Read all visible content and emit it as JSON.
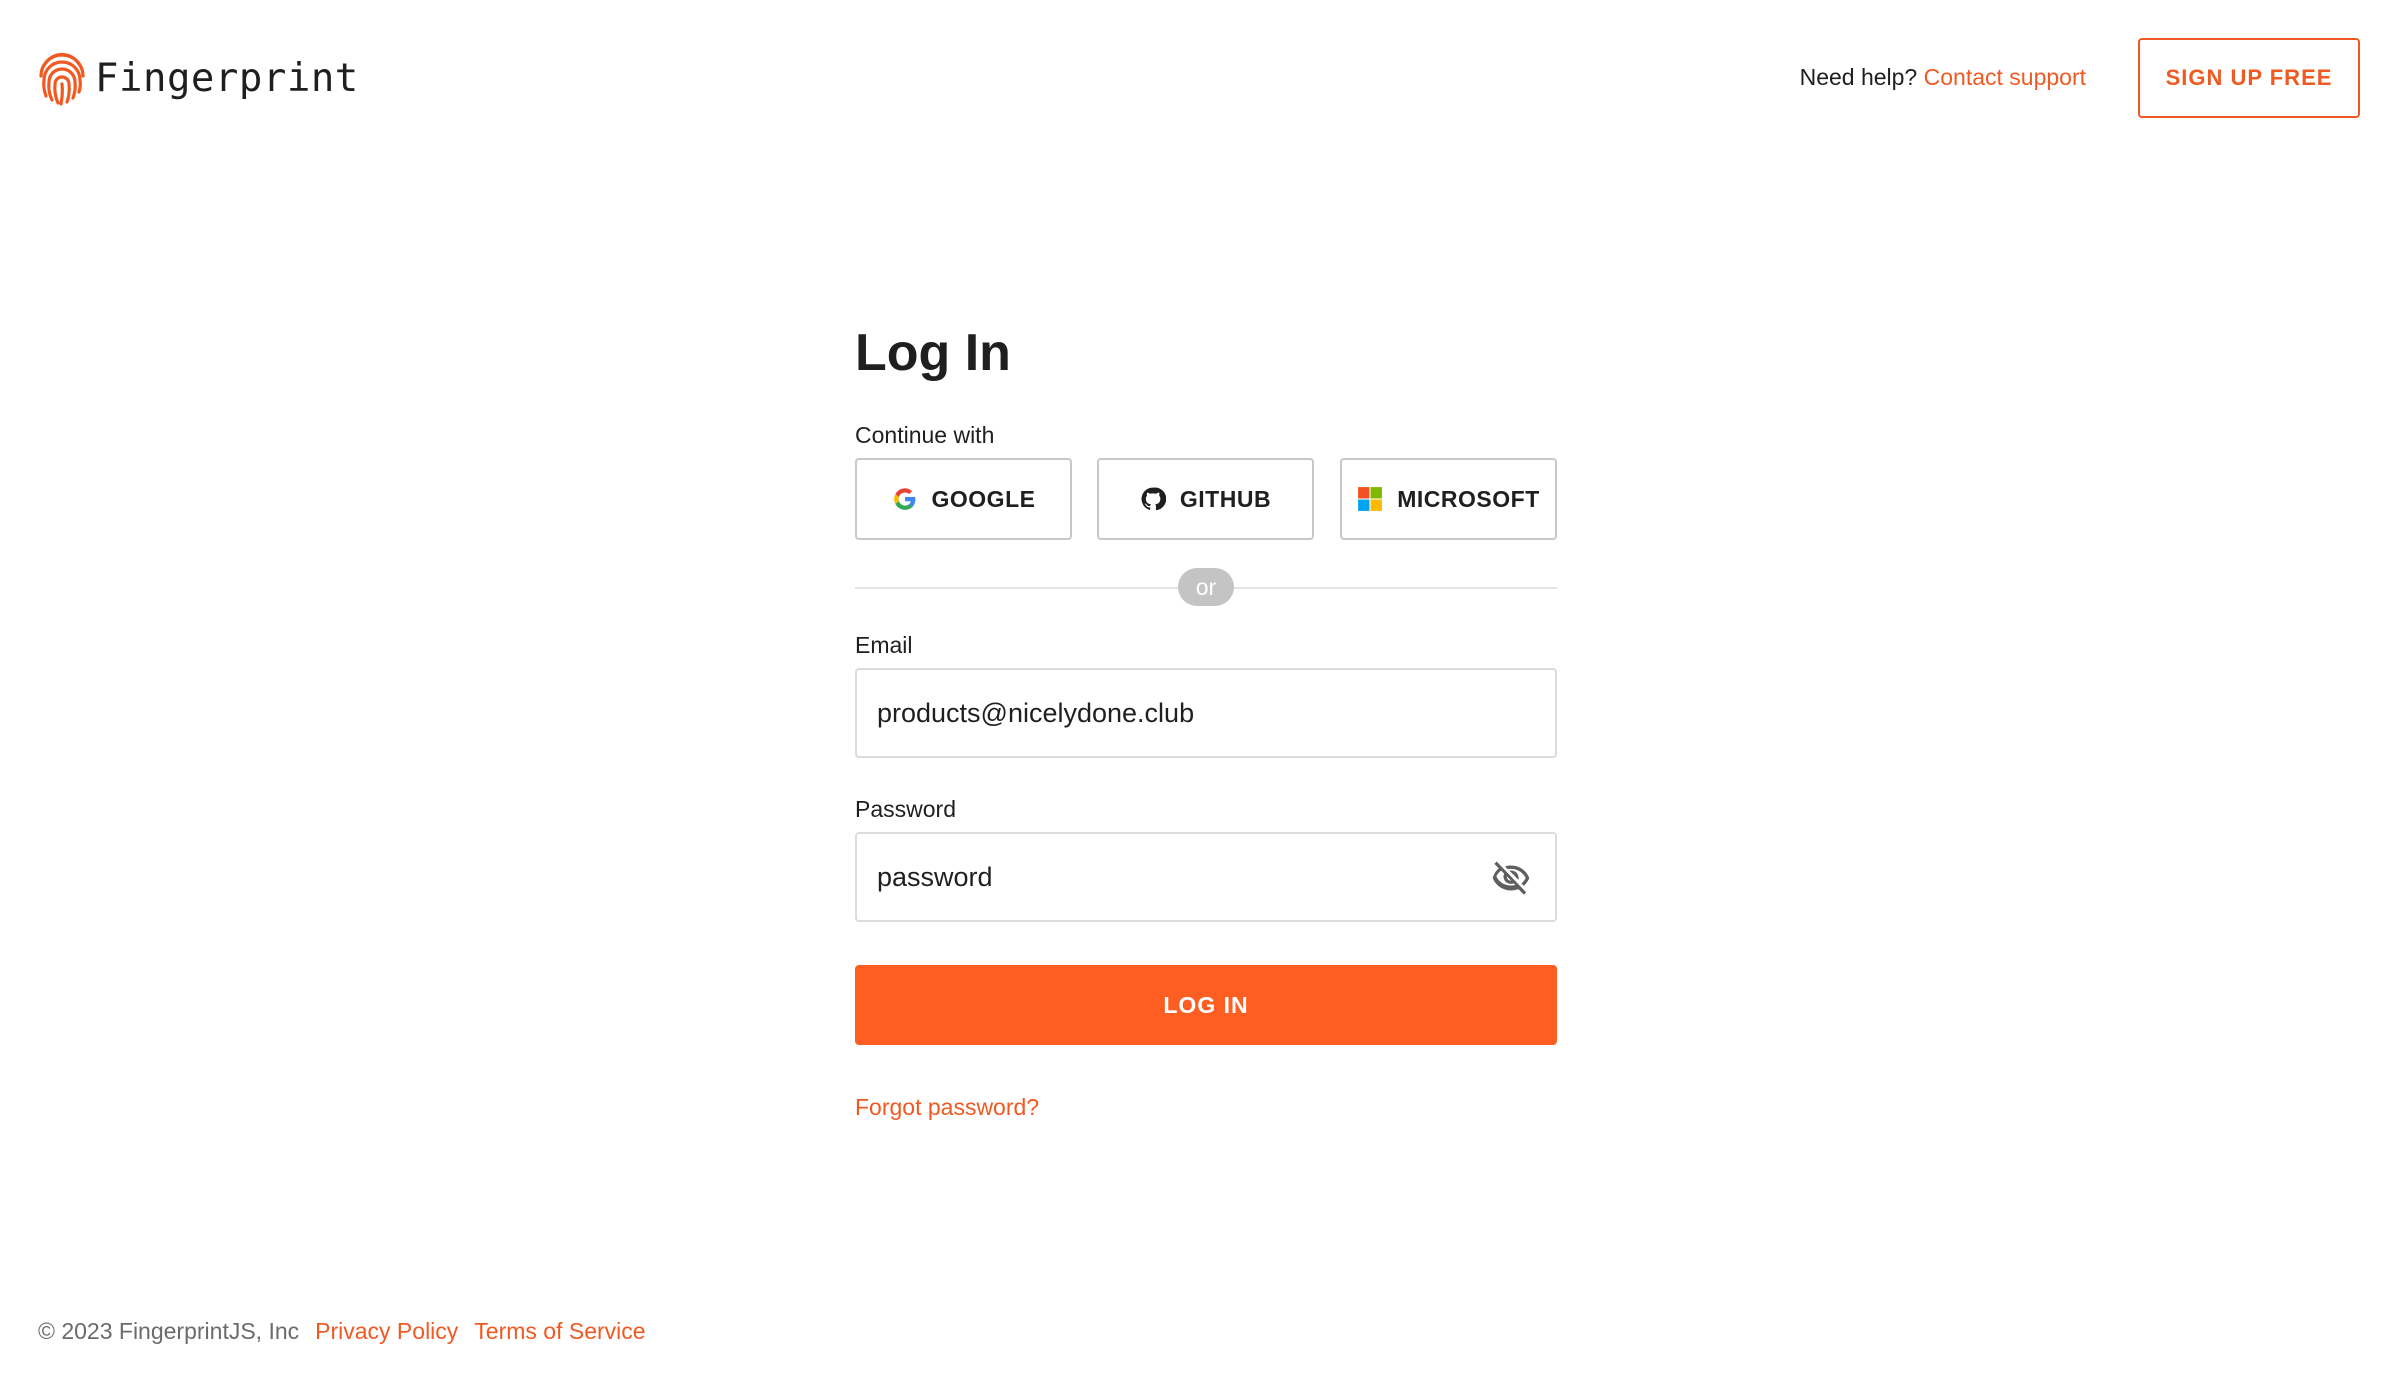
{
  "header": {
    "logo_text": "Fingerprint",
    "logo_icon": "fingerprint-icon",
    "help_text": "Need help?",
    "contact_link": "Contact support",
    "signup_label": "SIGN UP FREE"
  },
  "main": {
    "title": "Log In",
    "continue_label": "Continue with",
    "oauth": [
      {
        "label": "GOOGLE",
        "icon": "google-icon"
      },
      {
        "label": "GITHUB",
        "icon": "github-icon"
      },
      {
        "label": "MICROSOFT",
        "icon": "microsoft-icon"
      }
    ],
    "or_text": "or",
    "email": {
      "label": "Email",
      "value": "products@nicelydone.club"
    },
    "password": {
      "label": "Password",
      "value": "password",
      "toggle_icon": "eye-off-icon"
    },
    "login_label": "LOG IN",
    "forgot_label": "Forgot password?"
  },
  "footer": {
    "copyright": "© 2023 FingerprintJS, Inc",
    "privacy": "Privacy Policy",
    "terms": "Terms of Service"
  },
  "colors": {
    "accent": "#f05a22",
    "primary_button": "#ff5e23",
    "text": "#1f1f1f",
    "muted": "#6b6b6b"
  }
}
